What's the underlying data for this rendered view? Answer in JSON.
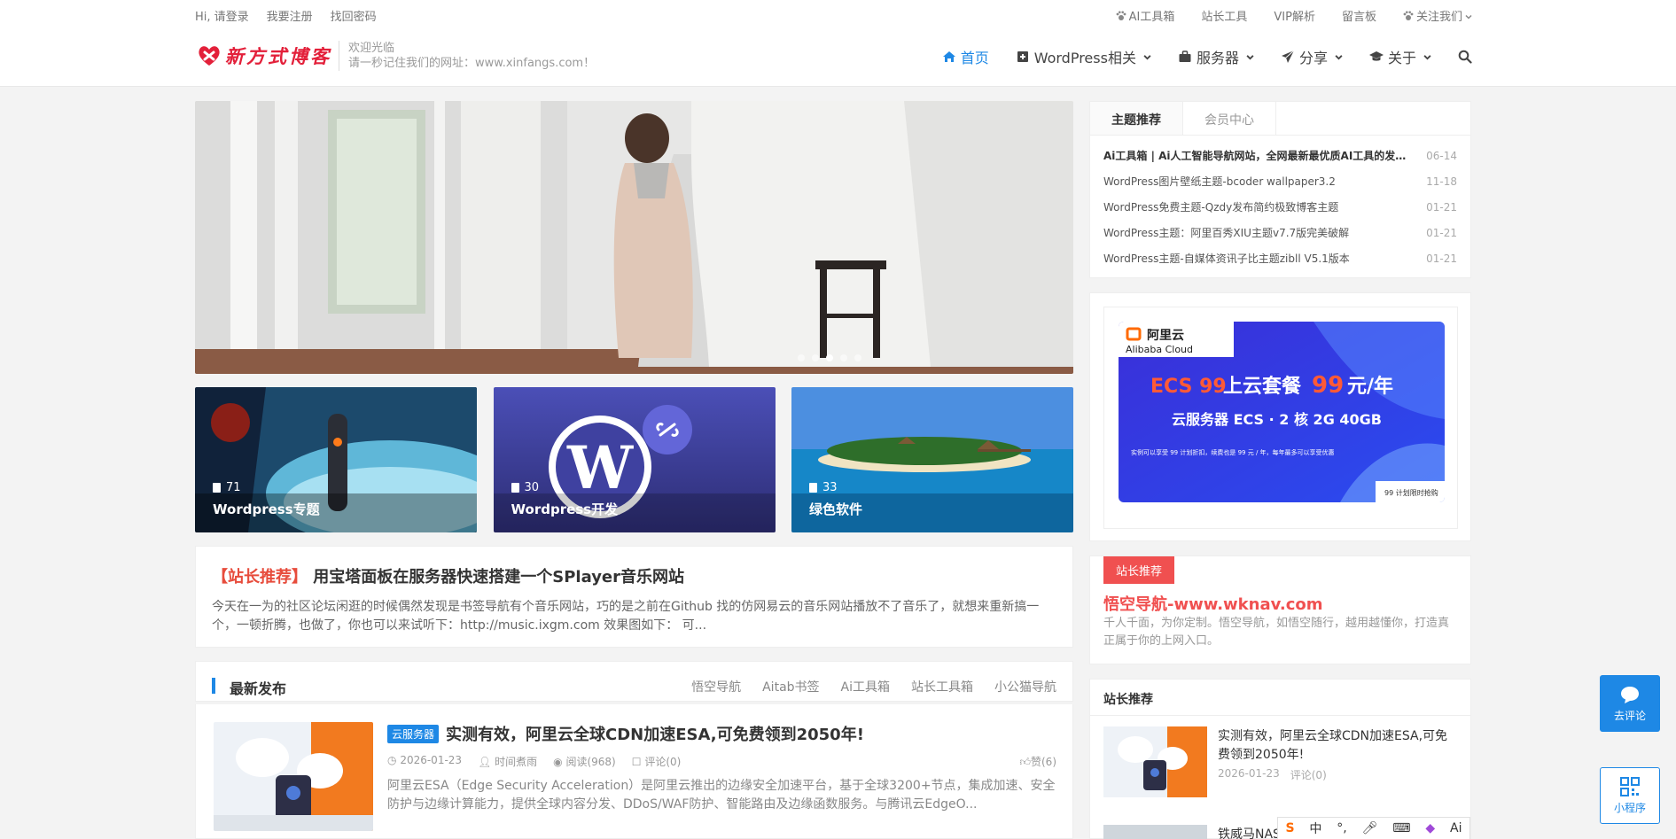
{
  "topbar": {
    "login": "Hi, 请登录",
    "register": "我要注册",
    "recover": "找回密码",
    "right_links": [
      "AI工具箱",
      "站长工具",
      "VIP解析",
      "留言板",
      "关注我们"
    ]
  },
  "header": {
    "logo_text": "新方式博客",
    "welcome_line1": "欢迎光临",
    "welcome_line2": "请一秒记住我们的网址：www.xinfangs.com！",
    "nav": [
      "首页",
      "WordPress相关",
      "服务器",
      "分享",
      "关于"
    ]
  },
  "slider": {
    "dot_count": 5,
    "active_dot": 3
  },
  "categories": [
    {
      "count": "71",
      "name": "Wordpress专题"
    },
    {
      "count": "30",
      "name": "Wordpress开发"
    },
    {
      "count": "33",
      "name": "绿色软件"
    }
  ],
  "featured": {
    "tag": "【站长推荐】",
    "title": "用宝塔面板在服务器快速搭建一个SPlayer音乐网站",
    "excerpt": "今天在一为的社区论坛闲逛的时候偶然发现是书签导航有个音乐网站，巧的是之前在Github 找的仿网易云的音乐网站播放不了音乐了，就想来重新搞一个，一顿折腾，也做了，你也可以来试听下：http://music.ixgm.com 效果图如下： 可..."
  },
  "latest": {
    "heading": "最新发布",
    "links": [
      "悟空导航",
      "Aitab书签",
      "Ai工具箱",
      "站长工具箱",
      "小公猫导航"
    ]
  },
  "post": {
    "badge": "云服务器",
    "title": "实测有效，阿里云全球CDN加速ESA,可免费领到2050年!",
    "date": "2026-01-23",
    "author": "时间煮雨",
    "views": "阅读(968)",
    "comments": "评论(0)",
    "likes": "赞(6)",
    "excerpt": "阿里云ESA（Edge Security Acceleration）是阿里云推出的边缘安全加速平台，基于全球3200+节点，集成加速、安全防护与边缘计算能力，提供全球内容分发、DDoS/WAF防护、智能路由及边缘函数服务。与腾讯云EdgeO..."
  },
  "sidebar": {
    "tabs": [
      "主题推荐",
      "会员中心"
    ],
    "topics": [
      {
        "title": "Ai工具箱 | Ai人工智能导航网站，全网最新最优质AI工具的发现...",
        "date": "06-14"
      },
      {
        "title": "WordPress图片壁纸主题-bcoder wallpaper3.2",
        "date": "11-18"
      },
      {
        "title": "WordPress免费主题-Qzdy发布简约极致博客主题",
        "date": "01-21"
      },
      {
        "title": "WordPress主题：阿里百秀XIU主题v7.7版完美破解",
        "date": "01-21"
      },
      {
        "title": "WordPress主题-自媒体资讯子比主题zibll V5.1版本",
        "date": "01-21"
      }
    ],
    "ad": {
      "brand_cn": "阿里云",
      "brand_en": "Alibaba Cloud",
      "headline_a": "ECS 99",
      "headline_b": "上云套餐",
      "headline_c": "99",
      "headline_d": "元/年",
      "sub": "云服务器 ECS · 2 核 2G 40GB",
      "small": "实例可以享受 99 计划折扣，续费也是 99 元 / 年，每年最多可以享受优惠",
      "tag": "99 计划限时抢购"
    },
    "recommend": {
      "label": "站长推荐",
      "site": "悟空导航-www.wknav.com",
      "desc": "千人千面，为你定制。悟空导航，如悟空随行，越用越懂你，打造真正属于你的上网入口。"
    },
    "site_rec": {
      "heading": "站长推荐",
      "title": "实测有效，阿里云全球CDN加速ESA,可免费领到2050年!",
      "date": "2026-01-23",
      "comments": "评论(0)",
      "second_title": "铁威马NAS"
    }
  },
  "float_buttons": {
    "comment": "去评论",
    "mini": "小程序"
  },
  "ime": [
    "中",
    "°,",
    "Ai"
  ]
}
